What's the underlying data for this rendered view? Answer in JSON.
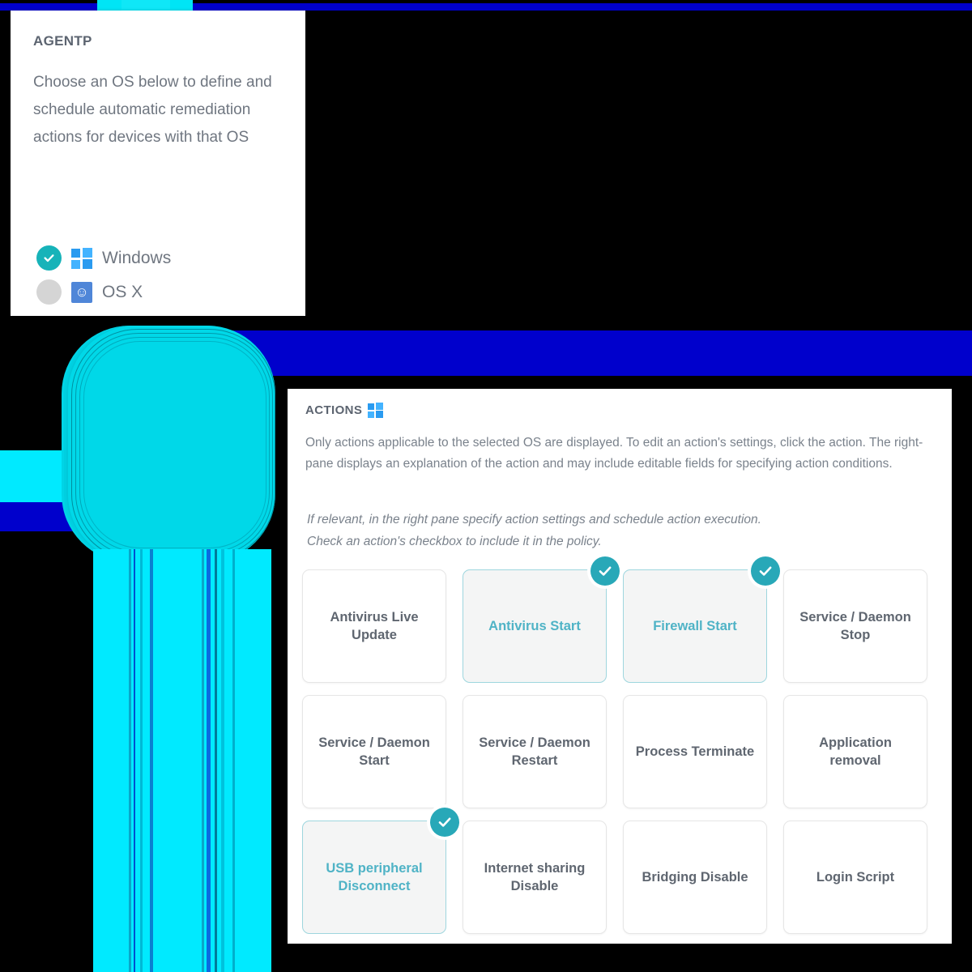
{
  "decor": {
    "cyan": "#00eaff",
    "blue": "#0000cc",
    "blob": "#00d8e8"
  },
  "agentp": {
    "title": "AGENTP",
    "description": "Choose an OS below to define and schedule automatic remediation actions for devices with that OS",
    "os_options": [
      {
        "label": "Windows",
        "selected": true,
        "icon": "windows-logo-icon"
      },
      {
        "label": "OS X",
        "selected": false,
        "icon": "finder-logo-icon"
      }
    ]
  },
  "actions": {
    "header": "ACTIONS",
    "header_icon": "windows-logo-icon",
    "description": "Only actions applicable to the selected OS are displayed. To edit an action's settings, click the action. The right-pane displays an explanation of the action and may include editable fields for specifying action conditions.",
    "notes": [
      "If relevant, in the right pane specify action settings and schedule action execution.",
      "Check an action's checkbox to include it in the policy."
    ],
    "cards": [
      {
        "label": "Antivirus Live Update",
        "selected": false
      },
      {
        "label": "Antivirus Start",
        "selected": true
      },
      {
        "label": "Firewall Start",
        "selected": true
      },
      {
        "label": "Service / Daemon Stop",
        "selected": false
      },
      {
        "label": "Service / Daemon Start",
        "selected": false
      },
      {
        "label": "Service / Daemon Restart",
        "selected": false
      },
      {
        "label": "Process Terminate",
        "selected": false
      },
      {
        "label": "Application removal",
        "selected": false
      },
      {
        "label": "USB peripheral Disconnect",
        "selected": true
      },
      {
        "label": "Internet sharing Disable",
        "selected": false
      },
      {
        "label": "Bridging Disable",
        "selected": false
      },
      {
        "label": "Login Script",
        "selected": false
      }
    ],
    "colors": {
      "selected_border": "#9ed6de",
      "selected_text": "#4fb3c6",
      "badge": "#28a8b8",
      "card_text": "#5f6670"
    }
  }
}
